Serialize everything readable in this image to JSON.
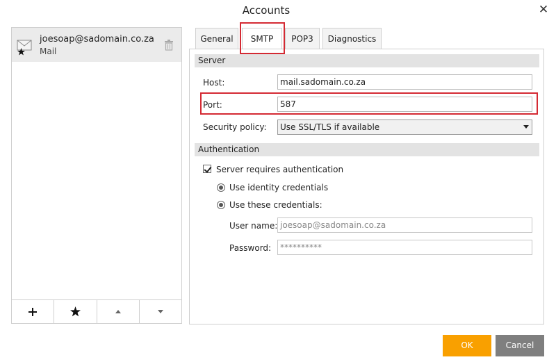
{
  "dialog": {
    "title": "Accounts"
  },
  "accounts": [
    {
      "email": "joesoap@sadomain.co.za",
      "type": "Mail"
    }
  ],
  "tabs": [
    "General",
    "SMTP",
    "POP3",
    "Diagnostics"
  ],
  "active_tab": "SMTP",
  "server": {
    "section_label": "Server",
    "host_label": "Host:",
    "host_value": "mail.sadomain.co.za",
    "port_label": "Port:",
    "port_value": "587",
    "security_label": "Security policy:",
    "security_value": "Use SSL/TLS if available"
  },
  "auth": {
    "section_label": "Authentication",
    "requires_auth_label": "Server requires authentication",
    "requires_auth_checked": true,
    "use_identity_label": "Use identity credentials",
    "use_these_label": "Use these credentials:",
    "username_label": "User name:",
    "username_placeholder": "joesoap@sadomain.co.za",
    "password_label": "Password:",
    "password_placeholder": "**********"
  },
  "buttons": {
    "ok": "OK",
    "cancel": "Cancel"
  },
  "colors": {
    "ok": "#f9a000",
    "cancel": "#7f7f7f",
    "highlight": "#d42a33",
    "section_header": "#e3e3e3"
  },
  "icons": {
    "account": "envelope-icon",
    "default_marker": "star-icon",
    "delete": "trash-icon",
    "add": "plus-icon",
    "set_default": "star-icon",
    "up": "arrow-up-icon",
    "down": "arrow-down-icon",
    "close": "close-icon"
  }
}
